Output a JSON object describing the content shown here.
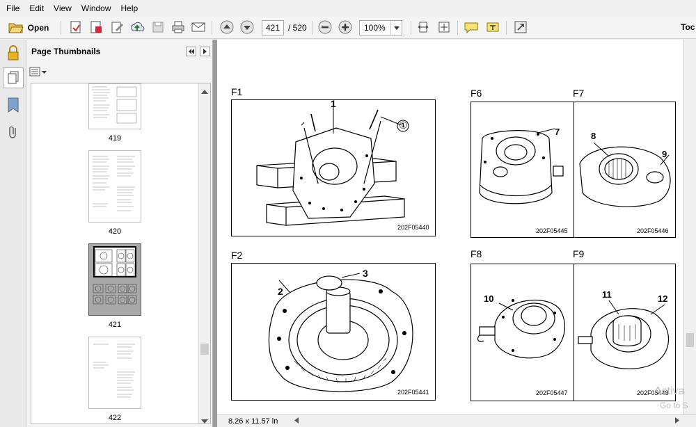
{
  "menu": [
    "File",
    "Edit",
    "View",
    "Window",
    "Help"
  ],
  "toolbar": {
    "open_label": "Open",
    "page_current": "421",
    "page_total": "/ 520",
    "zoom": "100%",
    "tools_label": "Toc"
  },
  "thumbnails": {
    "title": "Page Thumbnails",
    "pages": [
      "419",
      "420",
      "421",
      "422"
    ],
    "selected": "421"
  },
  "document": {
    "figures": [
      {
        "label": "F1",
        "callouts": [
          "1",
          "①"
        ],
        "code": "202F05440"
      },
      {
        "label": "F2",
        "callouts": [
          "2",
          "3"
        ],
        "code": "202F05441"
      },
      {
        "label": "F6",
        "callouts": [
          "7"
        ],
        "code": "202F05445"
      },
      {
        "label": "F7",
        "callouts": [
          "8",
          "9"
        ],
        "code": "202F05446"
      },
      {
        "label": "F8",
        "callouts": [
          "10"
        ],
        "code": "202F05447"
      },
      {
        "label": "F9",
        "callouts": [
          "11",
          "12"
        ],
        "code": "202F05448"
      }
    ]
  },
  "status": {
    "page_size": "8.26 x 11.57 in"
  },
  "watermark": {
    "line1": "Activa",
    "line2": "Go to S"
  },
  "icons": [
    "folder-open-icon",
    "create-pdf-icon",
    "document-icon",
    "edit-icon",
    "upload-icon",
    "save-icon",
    "print-icon",
    "email-icon",
    "page-up-icon",
    "page-down-icon",
    "zoom-out-icon",
    "zoom-in-icon",
    "fit-page-icon",
    "fit-width-icon",
    "comment-icon",
    "highlight-icon",
    "expand-icon",
    "lock-icon",
    "pages-icon",
    "bookmark-icon",
    "paperclip-icon"
  ]
}
